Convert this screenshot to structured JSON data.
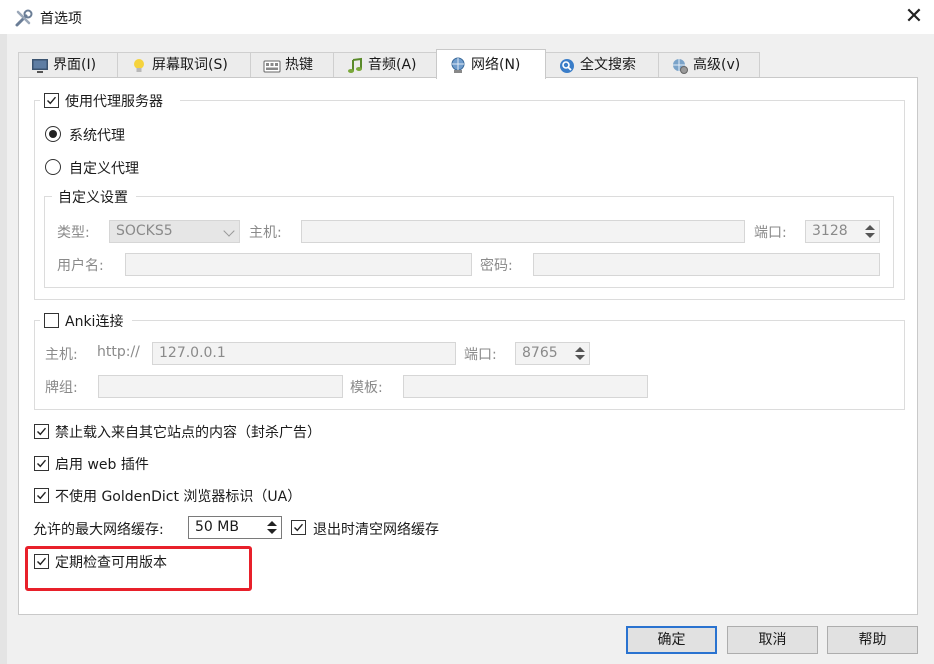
{
  "window": {
    "title": "首选项"
  },
  "tabs": [
    {
      "label": "界面(I)",
      "icon": "monitor-icon"
    },
    {
      "label": "屏幕取词(S)",
      "icon": "lightbulb-icon"
    },
    {
      "label": "热键",
      "icon": "keyboard-icon"
    },
    {
      "label": "音频(A)",
      "icon": "music-note-icon"
    },
    {
      "label": "网络(N)",
      "icon": "network-icon",
      "active": true
    },
    {
      "label": "全文搜索",
      "icon": "search-icon"
    },
    {
      "label": "高级(v)",
      "icon": "globe-gear-icon"
    }
  ],
  "proxy": {
    "enable_label": "使用代理服务器",
    "enabled": true,
    "system_label": "系统代理",
    "custom_label": "自定义代理",
    "custom_group_title": "自定义设置",
    "type_label": "类型:",
    "type_value": "SOCKS5",
    "host_label": "主机:",
    "host_value": "",
    "port_label": "端口:",
    "port_value": "3128",
    "username_label": "用户名:",
    "username_value": "",
    "password_label": "密码:",
    "password_value": ""
  },
  "anki": {
    "enable_label": "Anki连接",
    "enabled": false,
    "host_label": "主机:",
    "scheme": "http://",
    "host_value": "127.0.0.1",
    "port_label": "端口:",
    "port_value": "8765",
    "deck_label": "牌组:",
    "deck_value": "",
    "model_label": "模板:",
    "model_value": ""
  },
  "options": {
    "block_content_label": "禁止载入来自其它站点的内容（封杀广告）",
    "web_plugins_label": "启用 web 插件",
    "no_ua_label": "不使用 GoldenDict 浏览器标识（UA）",
    "max_cache_label": "允许的最大网络缓存:",
    "max_cache_value": "50 MB",
    "clear_cache_label": "退出时清空网络缓存",
    "check_updates_label": "定期检查可用版本"
  },
  "buttons": {
    "ok": "确定",
    "cancel": "取消",
    "help": "帮助"
  },
  "colors": {
    "highlight": "#e8202a",
    "primary_border": "#2a73d0"
  }
}
